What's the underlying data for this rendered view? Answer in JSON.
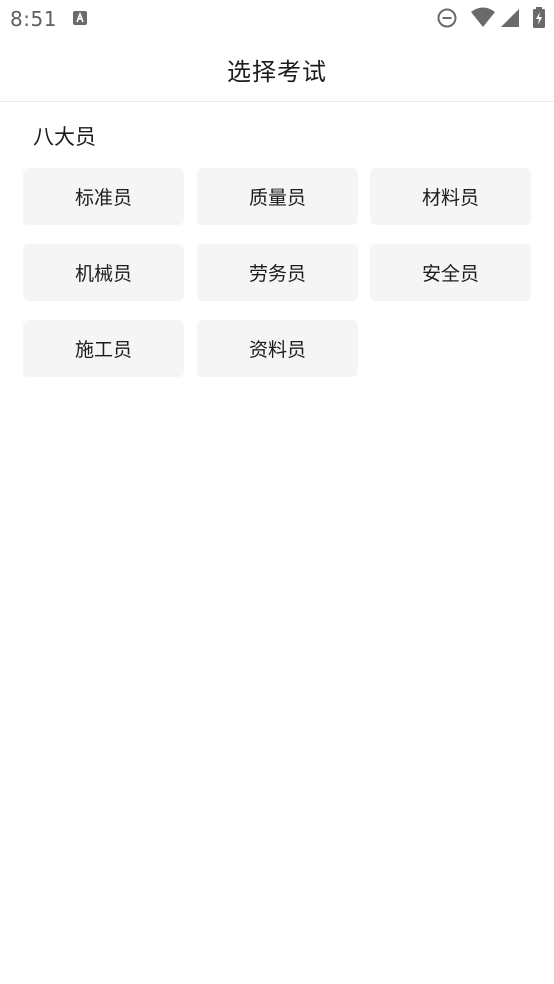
{
  "status_bar": {
    "time": "8:51",
    "notification_icon": "app-notification-icon",
    "icons": [
      "do-not-disturb-icon",
      "wifi-icon",
      "cellular-signal-icon",
      "battery-charging-icon"
    ]
  },
  "app_bar": {
    "title": "选择考试"
  },
  "section": {
    "title": "八大员",
    "items": [
      {
        "label": "标准员"
      },
      {
        "label": "质量员"
      },
      {
        "label": "材料员"
      },
      {
        "label": "机械员"
      },
      {
        "label": "劳务员"
      },
      {
        "label": "安全员"
      },
      {
        "label": "施工员"
      },
      {
        "label": "资料员"
      }
    ]
  },
  "colors": {
    "tile_background": "#f5f5f5",
    "background": "#ffffff",
    "text": "#1c1c1c"
  }
}
